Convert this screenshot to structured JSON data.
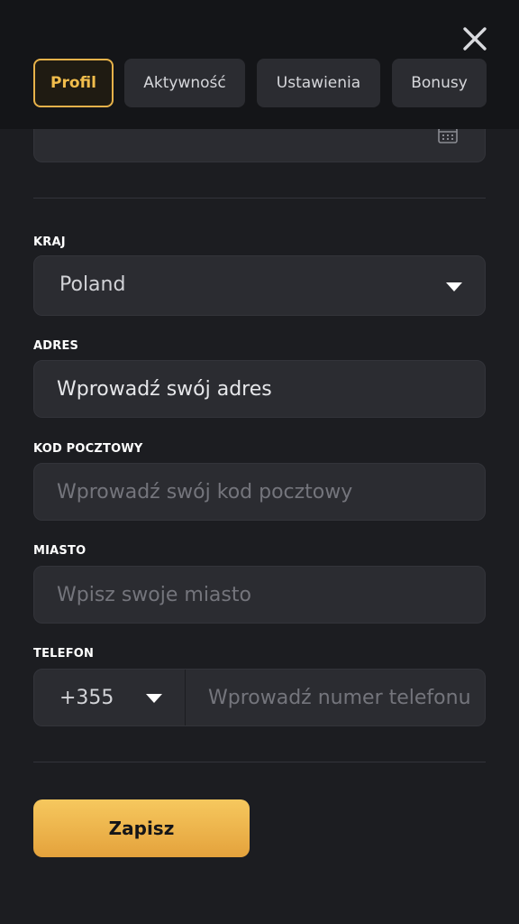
{
  "tabs": [
    {
      "label": "Profil",
      "active": true
    },
    {
      "label": "Aktywność",
      "active": false
    },
    {
      "label": "Ustawienia",
      "active": false
    },
    {
      "label": "Bonusy",
      "active": false
    }
  ],
  "icons": {
    "close": "close-icon",
    "calendar": "calendar-icon",
    "dropdown": "chevron-down-icon"
  },
  "colors": {
    "accent": "#f1bd4c",
    "background": "#1c1d21",
    "field": "#2b2c31",
    "header": "#141518"
  },
  "form": {
    "country": {
      "label": "KRAJ",
      "value": "Poland"
    },
    "address": {
      "label": "ADRES",
      "value": "Wprowadź swój adres"
    },
    "postal_code": {
      "label": "KOD POCZTOWY",
      "placeholder": "Wprowadź swój kod pocztowy"
    },
    "city": {
      "label": "MIASTO",
      "placeholder": "Wpisz swoje miasto"
    },
    "phone": {
      "label": "TELEFON",
      "code": "+355",
      "placeholder": "Wprowadź numer telefonu"
    }
  },
  "save_label": "Zapisz"
}
